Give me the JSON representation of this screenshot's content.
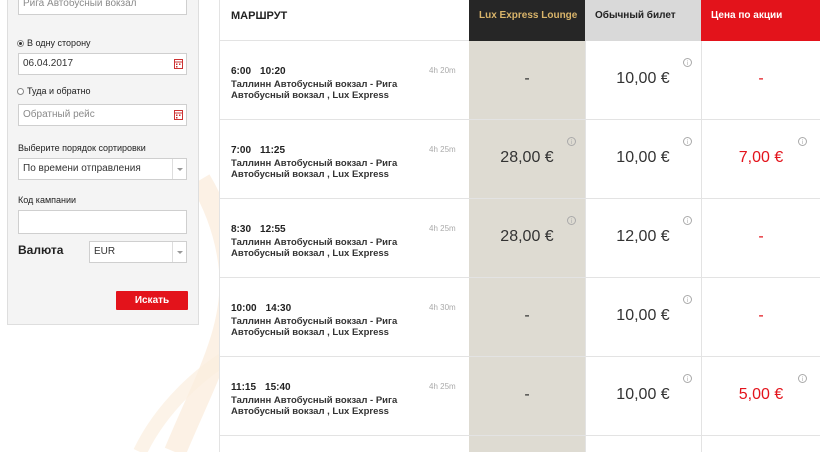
{
  "search": {
    "from_value": "Рига Автобусный вокзал",
    "one_way_label": "В одну сторону",
    "depart_date": "06.04.2017",
    "round_trip_label": "Туда и обратно",
    "return_placeholder": "Обратный рейс",
    "sort_label": "Выберите порядок сортировки",
    "sort_value": "По времени отправления",
    "campaign_label": "Код кампании",
    "campaign_value": "",
    "currency_label": "Валюта",
    "currency_value": "EUR",
    "search_button": "Искать"
  },
  "table": {
    "headers": {
      "route": "МАРШРУТ",
      "lux": "Lux Express Lounge",
      "standard": "Обычный билет",
      "promo": "Цена по акции"
    },
    "rows": [
      {
        "depart": "6:00",
        "arrive": "10:20",
        "duration": "4h 20m",
        "route": "Таллинн Автобусный вокзал - Рига Автобусный вокзал , Lux Express",
        "lux": "-",
        "standard": "10,00 €",
        "promo": "-"
      },
      {
        "depart": "7:00",
        "arrive": "11:25",
        "duration": "4h 25m",
        "route": "Таллинн Автобусный вокзал - Рига Автобусный вокзал , Lux Express",
        "lux": "28,00 €",
        "standard": "10,00 €",
        "promo": "7,00 €"
      },
      {
        "depart": "8:30",
        "arrive": "12:55",
        "duration": "4h 25m",
        "route": "Таллинн Автобусный вокзал - Рига Автобусный вокзал , Lux Express",
        "lux": "28,00 €",
        "standard": "12,00 €",
        "promo": "-"
      },
      {
        "depart": "10:00",
        "arrive": "14:30",
        "duration": "4h 30m",
        "route": "Таллинн Автобусный вокзал - Рига Автобусный вокзал , Lux Express",
        "lux": "-",
        "standard": "10,00 €",
        "promo": "-"
      },
      {
        "depart": "11:15",
        "arrive": "15:40",
        "duration": "4h 25m",
        "route": "Таллинн Автобусный вокзал - Рига Автобусный вокзал , Lux Express",
        "lux": "-",
        "standard": "10,00 €",
        "promo": "5,00 €"
      }
    ]
  },
  "colors": {
    "accent_red": "#e3131b",
    "lounge_header": "#262626",
    "lounge_gold": "#d9b46a",
    "lounge_column": "#dedbd2"
  }
}
